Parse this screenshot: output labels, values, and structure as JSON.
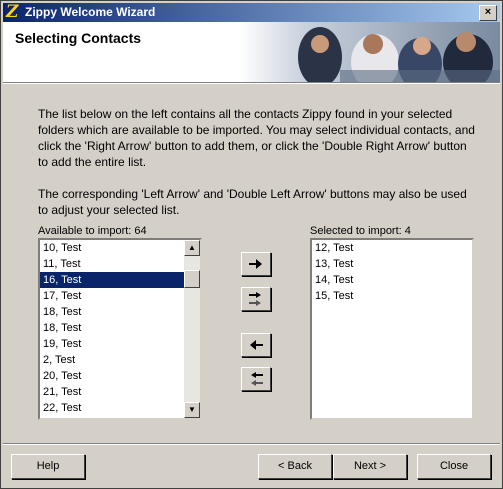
{
  "window": {
    "title": "Zippy Welcome Wizard",
    "close_label": "×"
  },
  "header": {
    "heading": "Selecting Contacts"
  },
  "description": {
    "paragraph1": "The list below on the left contains all the contacts Zippy found in your selected folders which are available to be imported. You may select individual contacts, and click the 'Right Arrow' button to add them, or click the 'Double Right Arrow' button to add the entire list.",
    "paragraph2": "The corresponding 'Left Arrow' and 'Double Left Arrow' buttons may also be used to adjust your selected list."
  },
  "available": {
    "label": "Available to import: 64",
    "items": [
      "10, Test",
      "11, Test",
      "16, Test",
      "17, Test",
      "18, Test",
      "18, Test",
      "19, Test",
      "2, Test",
      "20, Test",
      "21, Test",
      "22, Test"
    ],
    "selected_index": 2
  },
  "selected": {
    "label": "Selected to import: 4",
    "items": [
      "12, Test",
      "13, Test",
      "14, Test",
      "15, Test"
    ]
  },
  "buttons": {
    "help": "Help",
    "back": "< Back",
    "next": "Next >",
    "close": "Close"
  }
}
